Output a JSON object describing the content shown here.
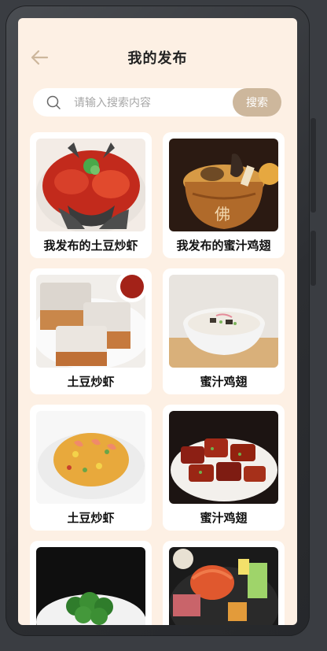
{
  "header": {
    "title": "我的发布"
  },
  "search": {
    "placeholder": "请输入搜索内容",
    "button_label": "搜索"
  },
  "colors": {
    "background": "#fdf0e4",
    "accent": "#cdb79c",
    "card": "#ffffff"
  },
  "posts": [
    {
      "title": "我发布的土豆炒虾",
      "image": "fish-head-chili"
    },
    {
      "title": "我发布的蜜汁鸡翅",
      "image": "buddha-jumps-over-wall"
    },
    {
      "title": "土豆炒虾",
      "image": "fried-tofu"
    },
    {
      "title": "蜜汁鸡翅",
      "image": "congee-bowl"
    },
    {
      "title": "土豆炒虾",
      "image": "shrimp-fried-rice"
    },
    {
      "title": "蜜汁鸡翅",
      "image": "braised-ribs"
    },
    {
      "title": "",
      "image": "broccoli-plate"
    },
    {
      "title": "",
      "image": "seafood-hotpot"
    }
  ]
}
